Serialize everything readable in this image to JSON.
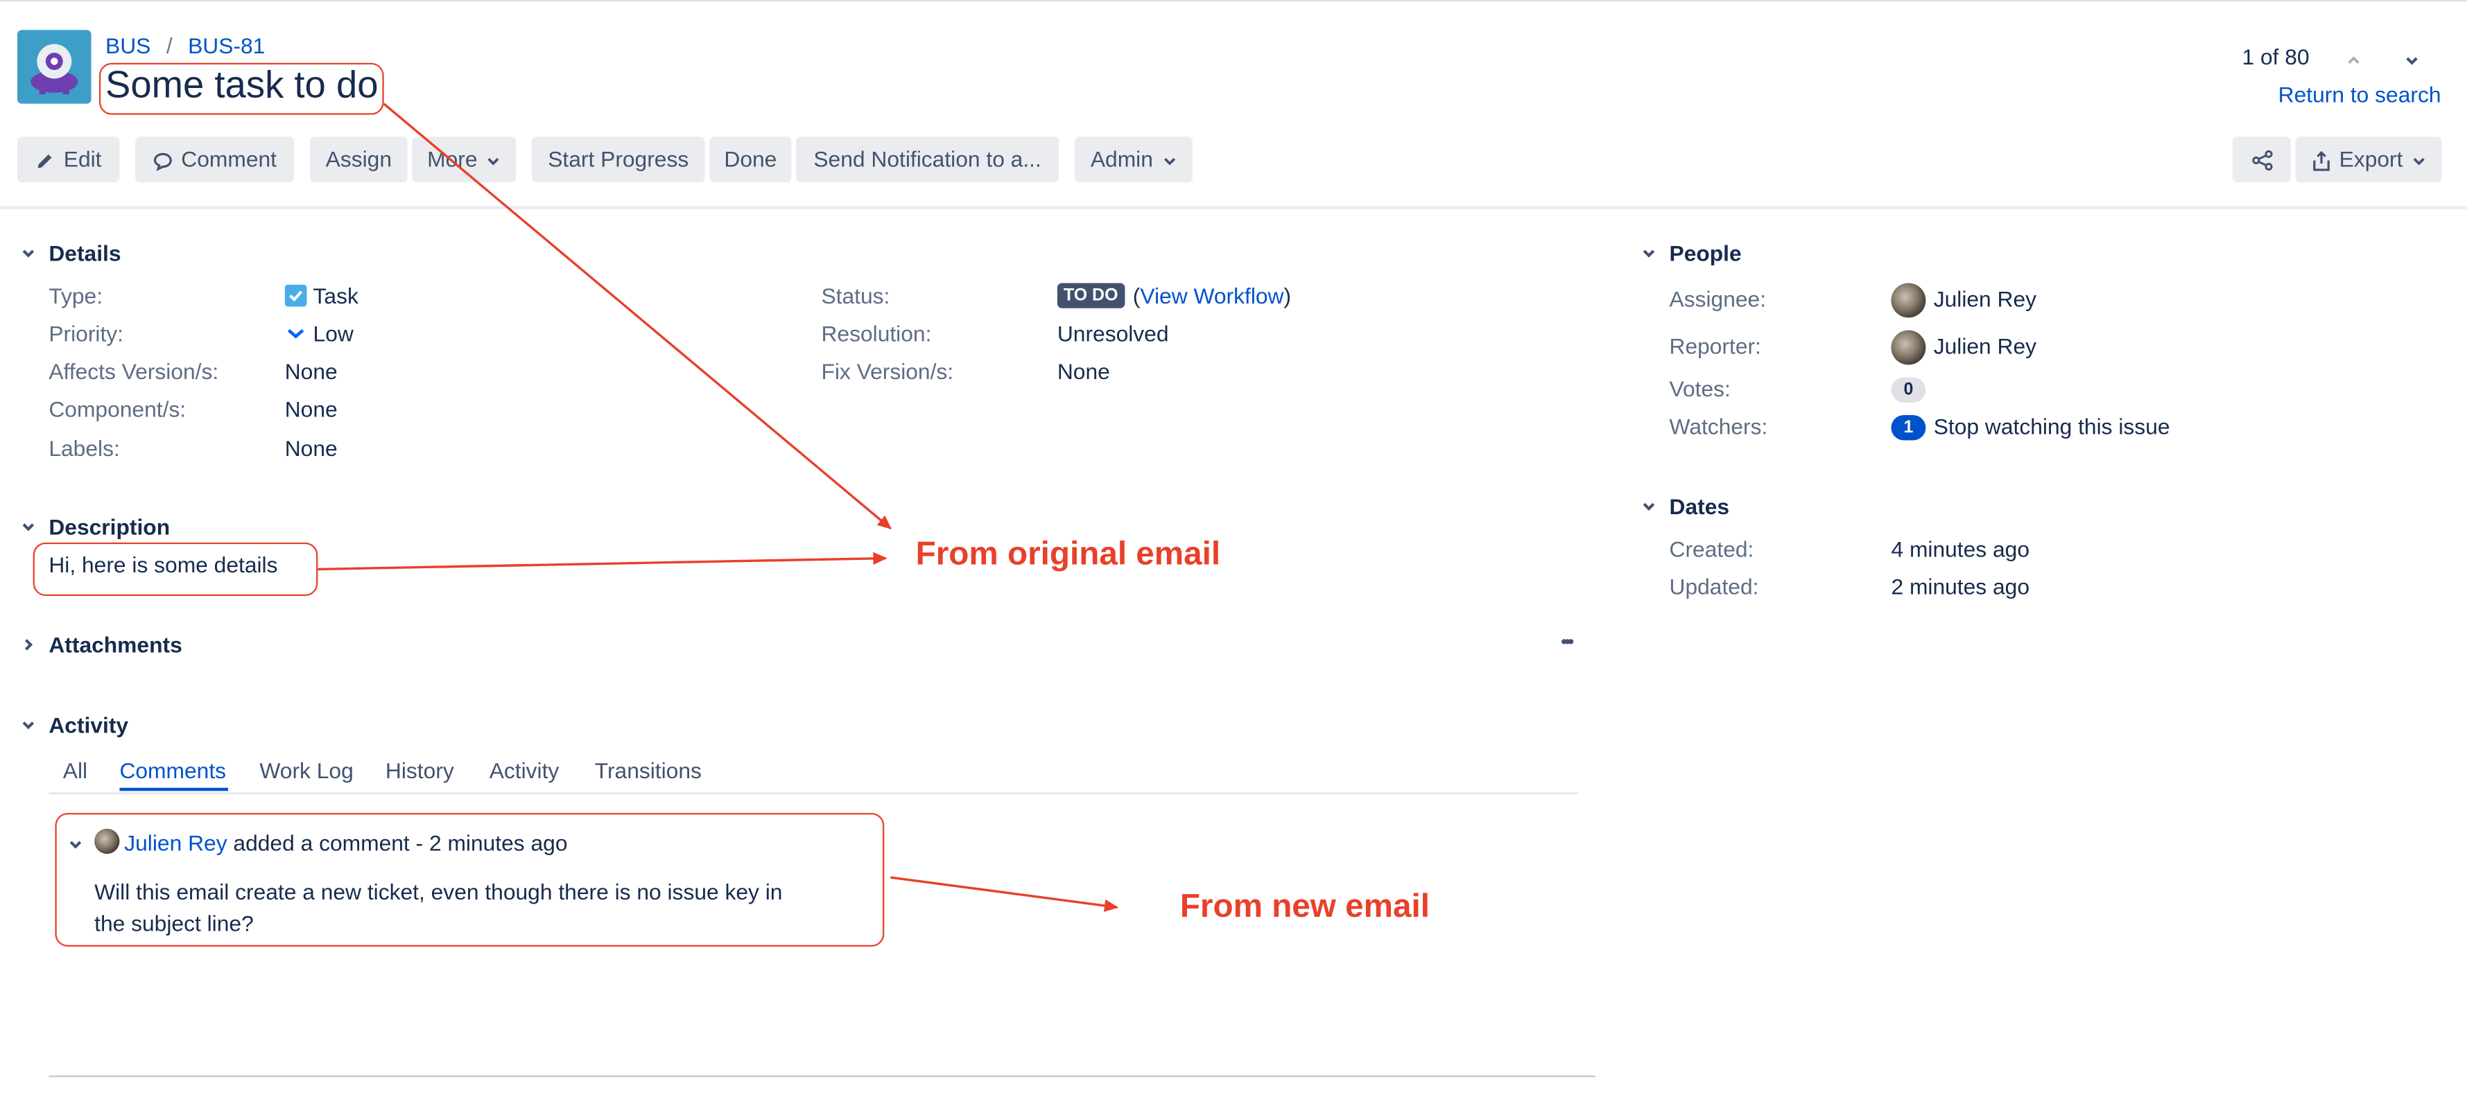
{
  "breadcrumb": {
    "project": "BUS",
    "separator": "/",
    "issue_key": "BUS-81"
  },
  "issue": {
    "title": "Some task to do"
  },
  "pager": {
    "position": "1 of 80",
    "return_label": "Return to search"
  },
  "toolbar": {
    "edit": "Edit",
    "comment": "Comment",
    "assign": "Assign",
    "more": "More",
    "start_progress": "Start Progress",
    "done": "Done",
    "send_notification": "Send Notification to a...",
    "admin": "Admin",
    "export": "Export"
  },
  "details": {
    "title": "Details",
    "type_label": "Type:",
    "type_value": "Task",
    "priority_label": "Priority:",
    "priority_value": "Low",
    "affects_label": "Affects Version/s:",
    "affects_value": "None",
    "component_label": "Component/s:",
    "component_value": "None",
    "labels_label": "Labels:",
    "labels_value": "None",
    "status_label": "Status:",
    "status_value": "TO DO",
    "workflow_open": "(",
    "workflow_link": "View Workflow",
    "workflow_close": ")",
    "resolution_label": "Resolution:",
    "resolution_value": "Unresolved",
    "fix_label": "Fix Version/s:",
    "fix_value": "None"
  },
  "description": {
    "title": "Description",
    "text": "Hi, here is some details"
  },
  "attachments": {
    "title": "Attachments",
    "menu": "•••"
  },
  "activity": {
    "title": "Activity",
    "tabs": [
      "All",
      "Comments",
      "Work Log",
      "History",
      "Activity",
      "Transitions"
    ],
    "active_tab": "Comments",
    "comment": {
      "author": "Julien Rey",
      "meta": "added a comment - 2 minutes ago",
      "body_line1": "Will this email create a new ticket, even though there is no issue key in",
      "body_line2": "the subject line?"
    }
  },
  "people": {
    "title": "People",
    "assignee_label": "Assignee:",
    "assignee_value": "Julien Rey",
    "reporter_label": "Reporter:",
    "reporter_value": "Julien Rey",
    "votes_label": "Votes:",
    "votes_value": "0",
    "watchers_label": "Watchers:",
    "watchers_value": "1",
    "watch_link": "Stop watching this issue"
  },
  "dates": {
    "title": "Dates",
    "created_label": "Created:",
    "created_value": "4 minutes ago",
    "updated_label": "Updated:",
    "updated_value": "2 minutes ago"
  },
  "annotations": {
    "original": "From original email",
    "new": "From new email"
  },
  "colors": {
    "accent": "#0052cc",
    "annotation_red": "#e8402a",
    "button_bg": "#ebecf0",
    "text": "#172b4d",
    "muted": "#5e6c84"
  }
}
